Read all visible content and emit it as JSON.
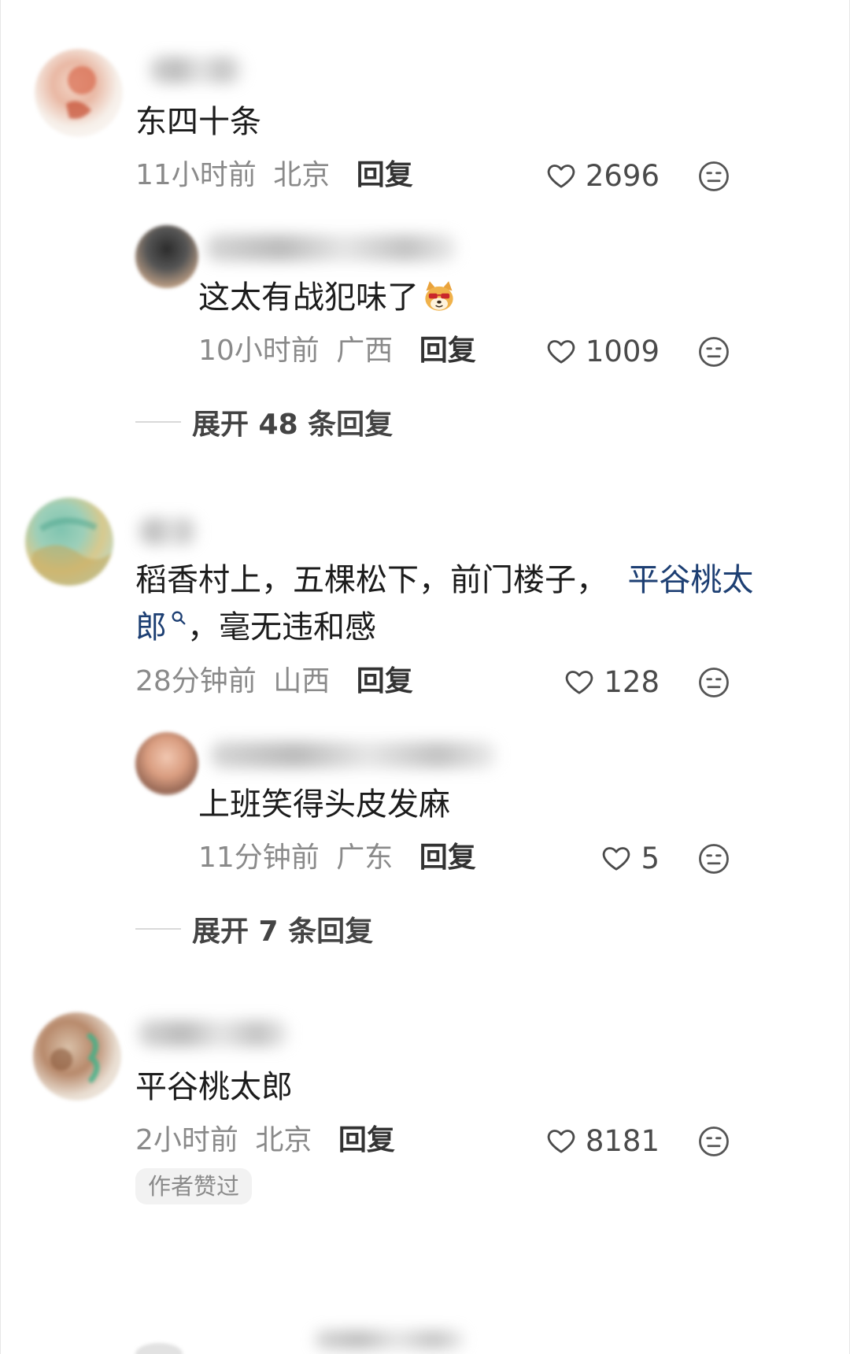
{
  "comments": [
    {
      "text": "东四十条",
      "time": "11小时前",
      "location": "北京",
      "reply_label": "回复",
      "likes": "2696",
      "replies": [
        {
          "text": "这太有战犯味了",
          "emoji": "doge-sunglasses-emoji",
          "time": "10小时前",
          "location": "广西",
          "reply_label": "回复",
          "likes": "1009"
        }
      ],
      "expand_label": "展开 48 条回复"
    },
    {
      "text_part1": "稻香村上，五棵松下，前门楼子，",
      "text_link": "平谷桃太",
      "text_line2_link": "郎",
      "text_line2_rest": "，毫无违和感",
      "time": "28分钟前",
      "location": "山西",
      "reply_label": "回复",
      "likes": "128",
      "replies": [
        {
          "text": "上班笑得头皮发麻",
          "time": "11分钟前",
          "location": "广东",
          "reply_label": "回复",
          "likes": "5"
        }
      ],
      "expand_label": "展开 7 条回复"
    },
    {
      "text": "平谷桃太郎",
      "time": "2小时前",
      "location": "北京",
      "reply_label": "回复",
      "likes": "8181",
      "badge": "作者赞过"
    }
  ],
  "icons": {
    "like": "heart-outline-icon",
    "dislike": "meh-face-icon",
    "search": "search-icon"
  },
  "colors": {
    "link": "#1d3f73",
    "meta": "#8a8a8a",
    "text": "#1c1c1c"
  }
}
